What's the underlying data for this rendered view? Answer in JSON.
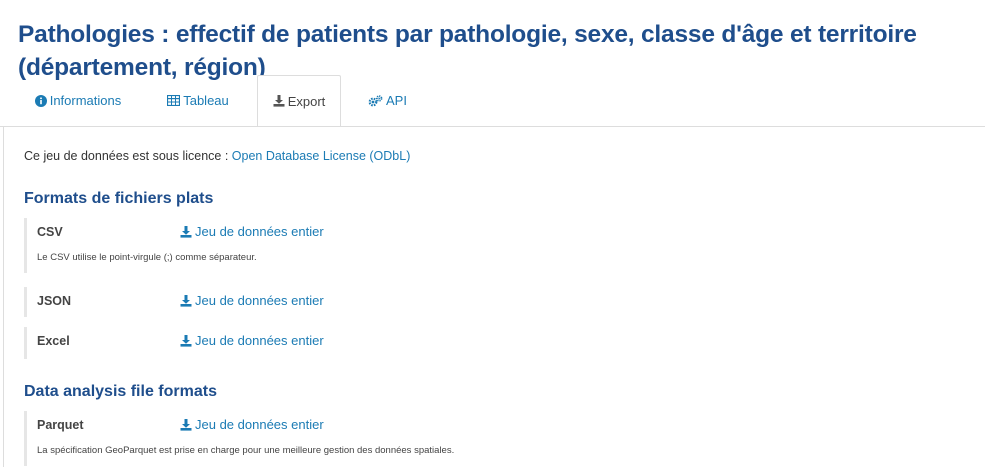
{
  "page": {
    "title": "Pathologies : effectif de patients par pathologie, sexe, classe d'âge et territoire (département, région)"
  },
  "tabs": [
    {
      "label": "Informations",
      "icon": "info-circle-icon"
    },
    {
      "label": "Tableau",
      "icon": "table-icon"
    },
    {
      "label": "Export",
      "icon": "download-icon",
      "active": true
    },
    {
      "label": "API",
      "icon": "cogs-icon"
    }
  ],
  "licence": {
    "prefix": "Ce jeu de données est sous licence : ",
    "link": "Open Database License (ODbL)"
  },
  "sections": [
    {
      "title": "Formats de fichiers plats",
      "formats": [
        {
          "name": "CSV",
          "link": "Jeu de données entier",
          "note": "Le CSV utilise le point-virgule (;) comme séparateur."
        },
        {
          "name": "JSON",
          "link": "Jeu de données entier"
        },
        {
          "name": "Excel",
          "link": "Jeu de données entier"
        }
      ]
    },
    {
      "title": "Data analysis file formats",
      "formats": [
        {
          "name": "Parquet",
          "link": "Jeu de données entier",
          "note": "La spécification GeoParquet est prise en charge pour une meilleure gestion des données spatiales."
        }
      ]
    }
  ],
  "colors": {
    "heading": "#1f4e8c",
    "link": "#1b7bb4"
  }
}
